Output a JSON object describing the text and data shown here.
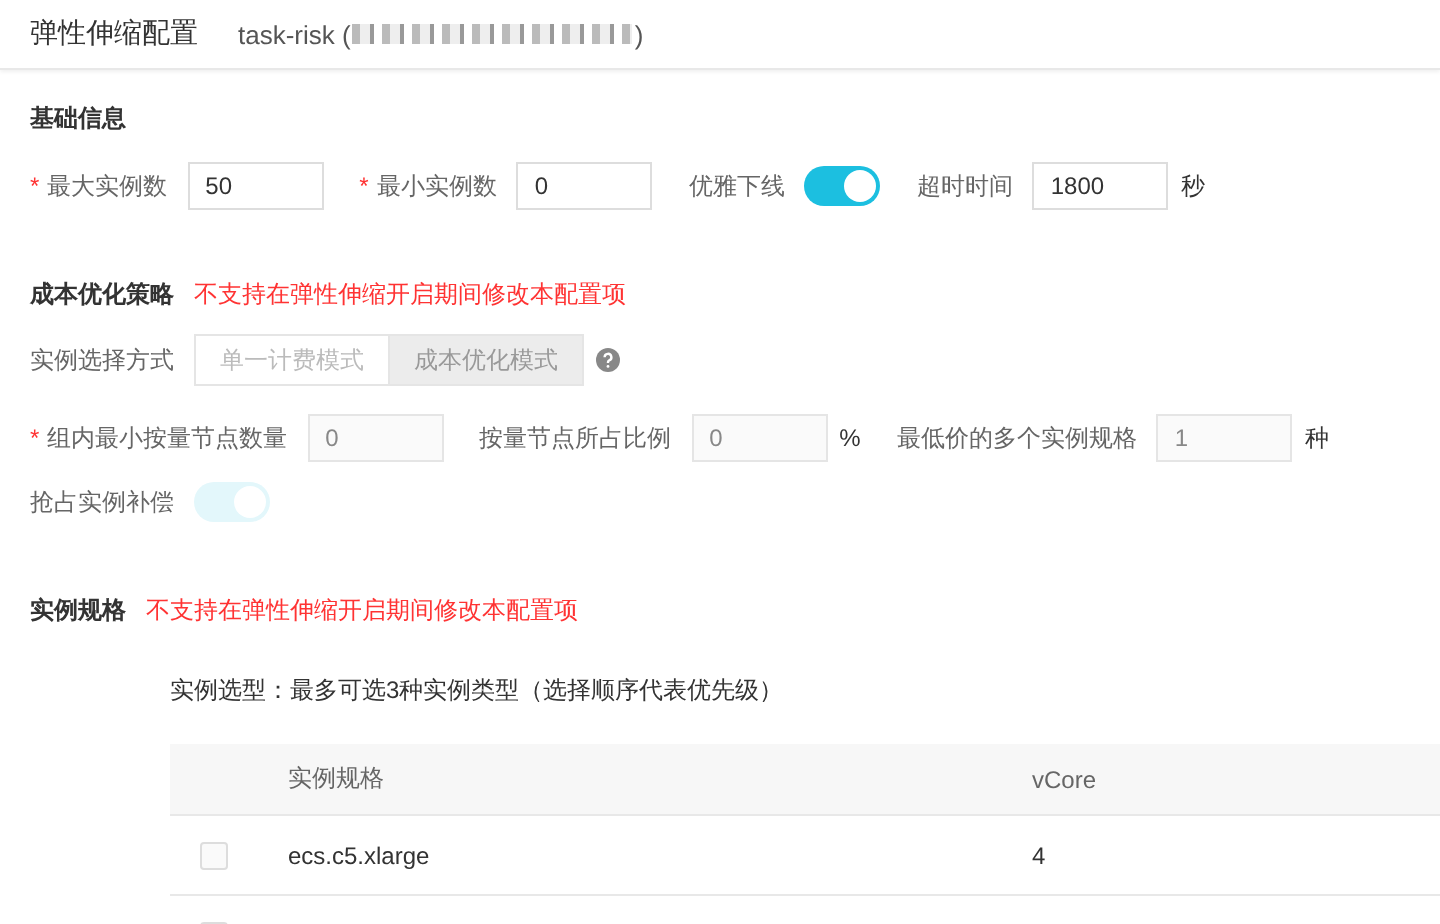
{
  "header": {
    "title": "弹性伸缩配置",
    "subtitle": "task-risk (",
    "subtitle_end": ")"
  },
  "basic": {
    "title": "基础信息",
    "fields": [
      {
        "kind": "input",
        "label": "最大实例数",
        "mark": "*",
        "value": "50",
        "disabled": false
      },
      {
        "kind": "input",
        "label": "最小实例数",
        "mark": "*",
        "value": "0",
        "disabled": false
      },
      {
        "kind": "switch",
        "label": "优雅下线",
        "on": true,
        "disabled": false
      },
      {
        "kind": "input",
        "label": "超时时间",
        "value": "1800",
        "unit": "秒",
        "disabled": false
      }
    ]
  },
  "cost": {
    "title": "成本优化策略",
    "warning": "不支持在弹性伸缩开启期间修改本配置项",
    "mode": {
      "label": "实例选择方式",
      "options": [
        {
          "label": "单一计费模式",
          "selected": false
        },
        {
          "label": "成本优化模式",
          "selected": true
        }
      ],
      "disabled": true
    },
    "fields": [
      {
        "kind": "input",
        "label": "组内最小按量节点数量",
        "mark": "*",
        "value": "0",
        "disabled": true
      },
      {
        "kind": "input",
        "label": "按量节点所占比例",
        "value": "0",
        "unit": "%",
        "disabled": true
      },
      {
        "kind": "input",
        "label": "最低价的多个实例规格",
        "value": "1",
        "unit": "种",
        "disabled": true
      }
    ],
    "spot": {
      "kind": "switch",
      "label": "抢占实例补偿",
      "on": true,
      "disabled": true
    }
  },
  "spec": {
    "title": "实例规格",
    "warning": "不支持在弹性伸缩开启期间修改本配置项",
    "hint": "实例选型：最多可选3种实例类型（选择顺序代表优先级）",
    "table": {
      "columns": [
        "实例规格",
        "vCore"
      ],
      "rows": [
        {
          "checked": false,
          "cells": [
            "ecs.c5.xlarge",
            "4"
          ]
        },
        {
          "checked": false,
          "cells": []
        }
      ]
    }
  }
}
